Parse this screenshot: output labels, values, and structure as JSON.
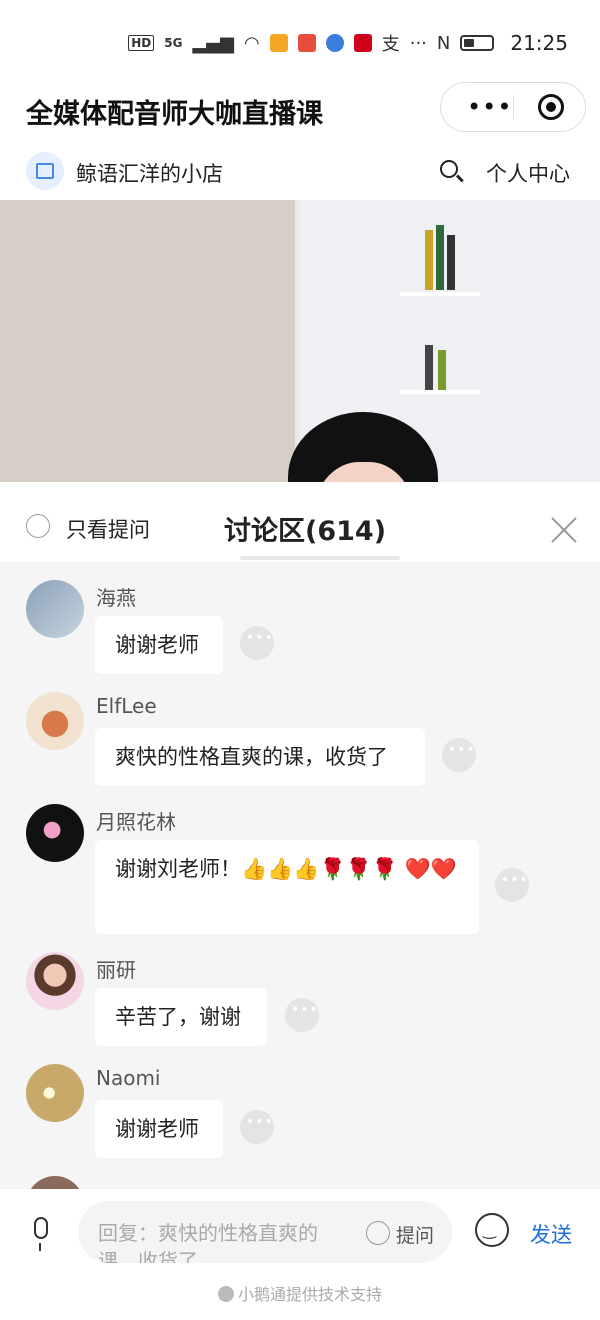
{
  "status_bar": {
    "network": "HD",
    "signal": "5G",
    "time": "21:25"
  },
  "title_bar": {
    "title": "全媒体配音师大咖直播课"
  },
  "shop_bar": {
    "shop_name": "鲸语汇洋的小店",
    "personal_center": "个人中心"
  },
  "discussion": {
    "only_questions": "只看提问",
    "title": "讨论区(614)",
    "messages": [
      {
        "user": "海燕",
        "text": "谢谢老师"
      },
      {
        "user": "ElfLee",
        "text": "爽快的性格直爽的课，收货了"
      },
      {
        "user": "月照花林",
        "text": "谢谢刘老师！👍👍👍🌹🌹🌹 ❤️❤️"
      },
      {
        "user": "丽研",
        "text": "辛苦了，谢谢"
      },
      {
        "user": "Naomi",
        "text": "谢谢老师"
      }
    ]
  },
  "input_bar": {
    "placeholder": "回复：爽快的性格直爽的课，收货了",
    "ask": "提问",
    "send": "发送"
  },
  "footer": {
    "text": "小鹅通提供技术支持"
  }
}
